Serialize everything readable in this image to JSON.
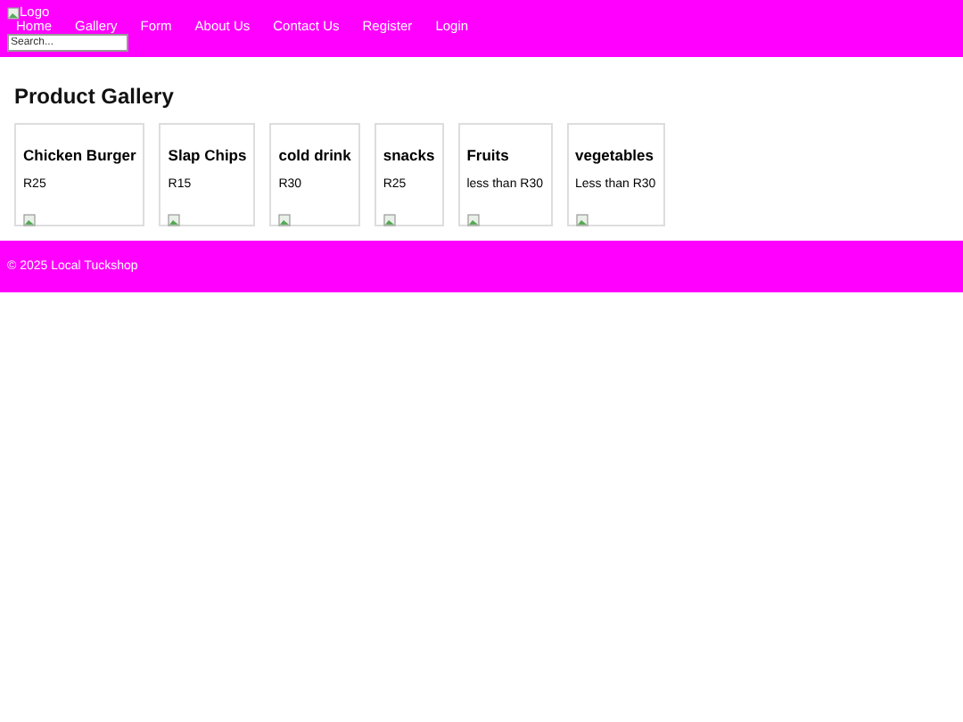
{
  "header": {
    "logo_alt": "Logo",
    "nav": [
      "Home",
      "Gallery",
      "Form",
      "About Us",
      "Contact Us",
      "Register",
      "Login"
    ],
    "search": {
      "placeholder": "Search..."
    }
  },
  "gallery": {
    "title": "Product Gallery",
    "products": [
      {
        "name": "Chicken Burger",
        "price": "R25"
      },
      {
        "name": "Slap Chips",
        "price": "R15"
      },
      {
        "name": "cold drink",
        "price": "R30"
      },
      {
        "name": "snacks",
        "price": "R25"
      },
      {
        "name": "Fruits",
        "price": "less than R30"
      },
      {
        "name": "vegetables",
        "price": "Less than R30"
      }
    ]
  },
  "footer": {
    "text": "© 2025 Local Tuckshop"
  }
}
